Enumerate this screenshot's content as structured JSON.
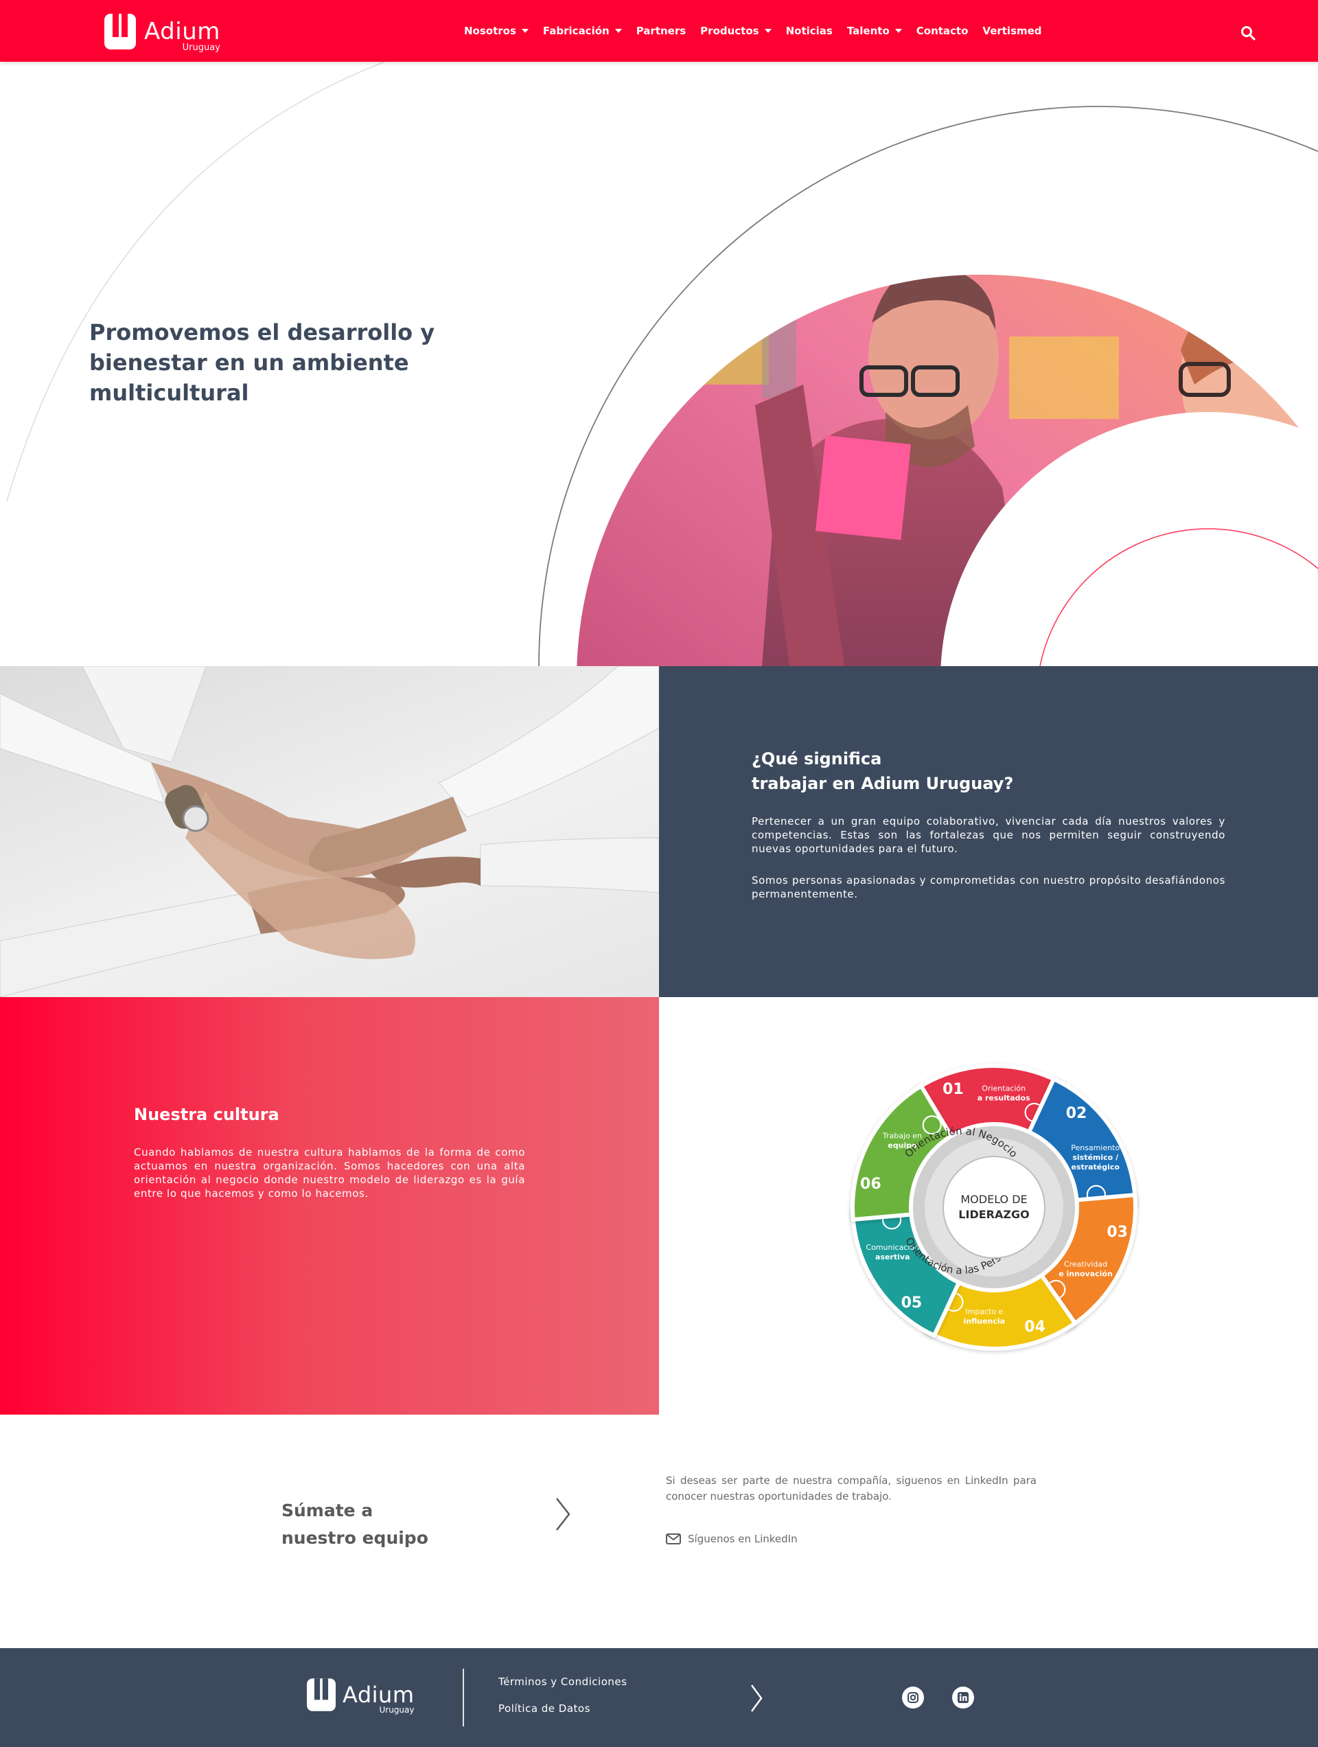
{
  "header": {
    "brand_name": "Adium",
    "brand_sub": "Uruguay",
    "nav": [
      {
        "label": "Nosotros",
        "has_dropdown": true
      },
      {
        "label": "Fabricación",
        "has_dropdown": true
      },
      {
        "label": "Partners",
        "has_dropdown": false
      },
      {
        "label": "Productos",
        "has_dropdown": true
      },
      {
        "label": "Noticias",
        "has_dropdown": false
      },
      {
        "label": "Talento",
        "has_dropdown": true
      },
      {
        "label": "Contacto",
        "has_dropdown": false
      },
      {
        "label": "Vertismed",
        "has_dropdown": false
      }
    ],
    "search_icon": "search-icon"
  },
  "hero": {
    "title": "Promovemos el desarrollo y bienestar en un ambiente multicultural"
  },
  "question": {
    "title_line1": "¿Qué significa",
    "title_line2": "trabajar en Adium Uruguay?",
    "paragraph1": "Pertenecer a un gran equipo colaborativo, vivenciar cada día nuestros valores y competencias. Estas son las fortalezas que nos permiten seguir construyendo nuevas oportunidades para el futuro.",
    "paragraph2": "Somos personas apasionadas y comprometidas con nuestro propósito desafiándonos permanentemente."
  },
  "culture": {
    "title": "Nuestra cultura",
    "paragraph": "Cuando hablamos de nuestra cultura hablamos de la forma de como actuamos en nuestra organización. Somos hacedores con una alta orientación al negocio donde nuestro modelo de liderazgo es la guía entre lo que hacemos y como lo hacemos."
  },
  "model": {
    "center_line1": "MODELO DE",
    "center_line2": "LIDERAZGO",
    "ring_top": "Orientación al Negocio",
    "ring_bottom": "Orientación a las Personas",
    "segments": [
      {
        "num": "01",
        "l1": "Orientación",
        "l2": "a resultados",
        "color": "#e8334a"
      },
      {
        "num": "02",
        "l1": "Pensamiento",
        "l2": "sistémico /",
        "l3": "estratégico",
        "color": "#1f6fb8"
      },
      {
        "num": "03",
        "l1": "Creatividad",
        "l2": "e innovación",
        "color": "#f28325"
      },
      {
        "num": "04",
        "l1": "Impacto e",
        "l2": "influencia",
        "color": "#f2c511"
      },
      {
        "num": "05",
        "l1": "Comunicación",
        "l2": "asertiva",
        "color": "#1f9e9a"
      },
      {
        "num": "06",
        "l1": "Trabajo en",
        "l2": "equipo",
        "color": "#6cb33e"
      }
    ]
  },
  "join": {
    "title_line1": "Súmate a",
    "title_line2": "nuestro equipo",
    "text": "Si deseas ser parte de nuestra compañía, siguenos en LinkedIn para conocer nuestras oportunidades de trabajo.",
    "link_label": "Síguenos en LinkedIn"
  },
  "footer": {
    "brand_name": "Adium",
    "brand_sub": "Uruguay",
    "links": [
      "Términos y Condiciones",
      "Política de Datos"
    ],
    "social": [
      "instagram-icon",
      "linkedin-icon"
    ]
  },
  "colors": {
    "brand_red": "#ff0033",
    "navy": "#3d4a5e"
  }
}
